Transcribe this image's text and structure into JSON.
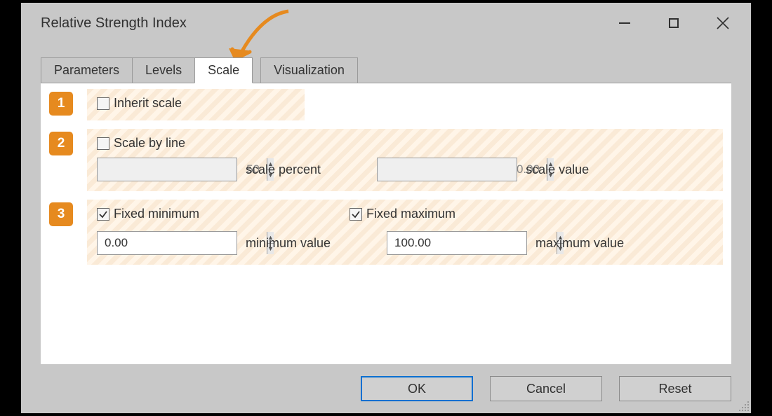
{
  "title": "Relative Strength Index",
  "tabs": {
    "parameters": "Parameters",
    "levels": "Levels",
    "scale": "Scale",
    "visualization": "Visualization"
  },
  "badges": {
    "one": "1",
    "two": "2",
    "three": "3"
  },
  "scale": {
    "inherit_label": "Inherit scale",
    "inherit_checked": false,
    "byline_label": "Scale by line",
    "byline_checked": false,
    "percent_value": "50",
    "percent_label": "scale percent",
    "value_value": "0.00",
    "value_label": "scale value",
    "fixedmin_label": "Fixed minimum",
    "fixedmin_checked": true,
    "fixedmax_label": "Fixed maximum",
    "fixedmax_checked": true,
    "min_value": "0.00",
    "min_label": "minimum value",
    "max_value": "100.00",
    "max_label": "maximum value"
  },
  "buttons": {
    "ok": "OK",
    "cancel": "Cancel",
    "reset": "Reset"
  }
}
